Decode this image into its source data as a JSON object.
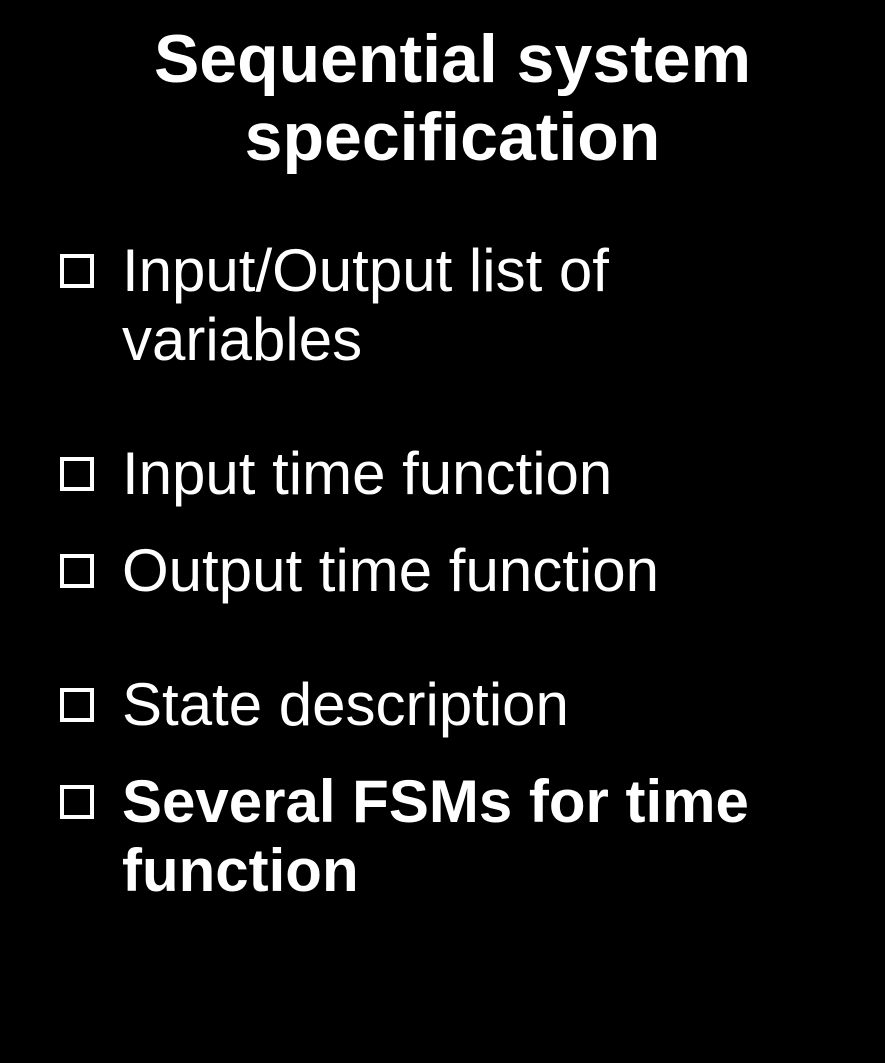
{
  "title": {
    "line1": "Sequential system",
    "line2": "specification"
  },
  "items": [
    {
      "text": "Input/Output list of variables",
      "bold": false
    },
    {
      "text": "Input time function",
      "bold": false
    },
    {
      "text": "Output time function",
      "bold": false
    },
    {
      "text": "State description",
      "bold": false
    },
    {
      "text": "Several FSMs for time function",
      "bold": true
    }
  ]
}
